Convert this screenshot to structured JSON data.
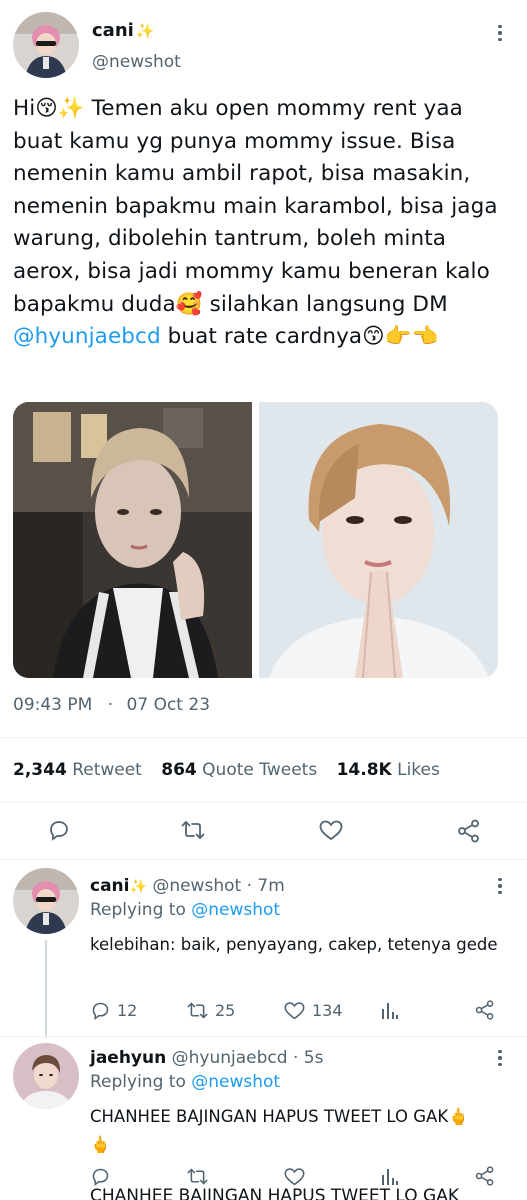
{
  "tweet": {
    "display_name": "cani",
    "display_emoji": "✨",
    "handle": "@newshot",
    "text": {
      "part1": "Hi",
      "emoji1": "😚✨",
      "part2": " Temen aku open mommy rent yaa buat kamu yg punya mommy issue. Bisa nemenin kamu ambil rapot, bisa masakin, nemenin bapakmu main karambol, bisa jaga warung, dibolehin tantrum, boleh minta aerox, bisa jadi mommy kamu beneran kalo bapakmu duda",
      "emoji2": "🥰",
      "part3": " silahkan langsung DM ",
      "mention": "@hyunjaebcd",
      "part4": " buat rate cardnya",
      "emoji3": "😙👉👈"
    },
    "time": "09:43 PM",
    "separator": "·",
    "date": "07 Oct 23",
    "stats": {
      "retweets": "2,344",
      "retweets_label": "Retweet",
      "quotes": "864",
      "quotes_label": "Quote Tweets",
      "likes": "14.8K",
      "likes_label": "Likes"
    }
  },
  "replies": [
    {
      "display_name": "cani",
      "display_emoji": "✨",
      "handle_time": "@newshot · 7m",
      "replying_prefix": "Replying to ",
      "replying_to": "@newshot",
      "text": "kelebihan: baik, penyayang, cakep, tetenya gede",
      "reply_count": "12",
      "retweet_count": "25",
      "like_count": "134"
    },
    {
      "display_name": "jaehyun",
      "handle_time": "@hyunjaebcd · 5s",
      "replying_prefix": "Replying to ",
      "replying_to": "@newshot",
      "text": "CHANHEE BAJINGAN HAPUS TWEET LO GAK",
      "text_emoji": "🖕",
      "text_emoji2": "🖕"
    }
  ],
  "cut_off_text": "CHANHEE BAJINGAN HAPUS TWEET LO GAK",
  "colors": {
    "accent": "#1d9bf0",
    "secondary_text": "#536471",
    "primary_text": "#0f1419",
    "divider": "#eff3f4"
  },
  "icons": [
    "more-icon",
    "reply-icon",
    "retweet-icon",
    "like-icon",
    "share-icon",
    "analytics-icon"
  ]
}
